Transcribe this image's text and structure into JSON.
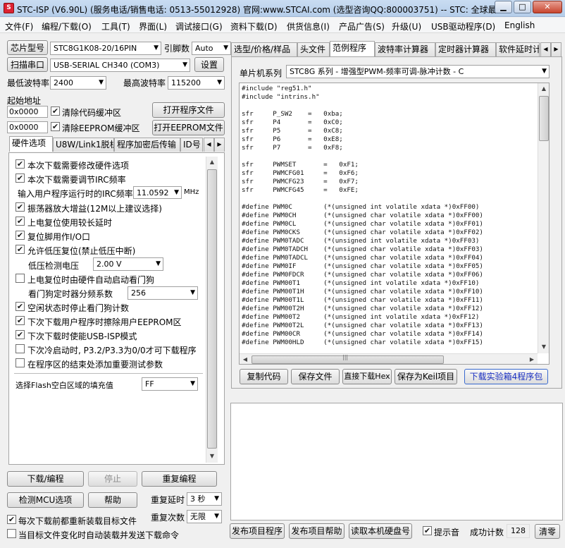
{
  "window": {
    "title": "STC-ISP (V6.90L) (服务电话/销售电话: 0513-55012928) 官网:www.STCAI.com  (选型咨询QQ:800003751) -- STC: 全球最…",
    "icon_letter": "S"
  },
  "menu": [
    "文件(F)",
    "编程/下载(O)",
    "工具(T)",
    "界面(L)",
    "调试接口(G)",
    "资料下载(D)",
    "供货信息(I)",
    "产品广告(S)",
    "升级(U)",
    "USB驱动程序(D)",
    "English"
  ],
  "chip": {
    "label": "芯片型号",
    "value": "STC8G1K08-20/16PIN",
    "pins_label": "引脚数",
    "pins_value": "Auto"
  },
  "port": {
    "button": "扫描串口",
    "value": "USB-SERIAL CH340  (COM3)",
    "settings": "设置"
  },
  "baud": {
    "min_label": "最低波特率",
    "min_value": "2400",
    "max_label": "最高波特率",
    "max_value": "115200"
  },
  "address": {
    "label": "起始地址",
    "code_addr": "0x0000",
    "code_clear": "清除代码缓冲区",
    "open_program": "打开程序文件",
    "eeprom_addr": "0x0000",
    "eeprom_clear": "清除EEPROM缓冲区",
    "open_eeprom": "打开EEPROM文件"
  },
  "left_tabs": [
    "硬件选项",
    "U8W/Link1脱机",
    "程序加密后传输",
    "ID号"
  ],
  "hw": {
    "opt1": "本次下载需要修改硬件选项",
    "opt2": "本次下载需要调节IRC频率",
    "irc_label": "输入用户程序运行时的IRC频率",
    "irc_value": "11.0592",
    "irc_unit": "MHz",
    "opt3": "振荡器放大增益(12M以上建议选择)",
    "opt4": "上电复位使用较长延时",
    "opt5": "复位脚用作I/O口",
    "opt6": "允许低压复位(禁止低压中断)",
    "lv_label": "低压检测电压",
    "lv_value": "2.00 V",
    "opt7": "上电复位时由硬件自动启动看门狗",
    "wdt_label": "看门狗定时器分频系数",
    "wdt_value": "256",
    "opt8": "空闲状态时停止看门狗计数",
    "opt9": "下次下载用户程序时擦除用户EEPROM区",
    "opt10": "下次下载时使能USB-ISP模式",
    "opt11": "下次冷启动时, P3.2/P3.3为0/0才可下载程序",
    "opt12": "在程序区的结束处添加重要测试参数",
    "fill_label": "选择Flash空白区域的填充值",
    "fill_value": "FF"
  },
  "actions": {
    "download": "下载/编程",
    "stop": "停止",
    "reprogram": "重复编程",
    "check_mcu": "检测MCU选项",
    "help": "帮助",
    "delay_label": "重复延时",
    "delay_value": "3 秒",
    "count_label": "重复次数",
    "count_value": "无限",
    "reload_each": "每次下载前都重新装载目标文件",
    "auto_reload": "当目标文件变化时自动装载并发送下载命令"
  },
  "right_tabs": [
    "选型/价格/样品",
    "头文件",
    "范例程序",
    "波特率计算器",
    "定时器计算器",
    "软件延时计"
  ],
  "sample": {
    "series_label": "单片机系列",
    "series_value": "STC8G 系列 - 增强型PWM-频率可调-脉冲计数 - C",
    "code": [
      "#include \"reg51.h\"",
      "#include \"intrins.h\"",
      "",
      "sfr     P_SW2    =   0xba;",
      "sfr     P4       =   0xC0;",
      "sfr     P5       =   0xC8;",
      "sfr     P6       =   0xE8;",
      "sfr     P7       =   0xF8;",
      "",
      "sfr     PWMSET       =   0xF1;",
      "sfr     PWMCFG01     =   0xF6;",
      "sfr     PWMCFG23     =   0xF7;",
      "sfr     PWMCFG45     =   0xFE;",
      "",
      "#define PWM0C        (*(unsigned int volatile xdata *)0xFF00)",
      "#define PWM0CH       (*(unsigned char volatile xdata *)0xFF00)",
      "#define PWM0CL       (*(unsigned char volatile xdata *)0xFF01)",
      "#define PWM0CKS      (*(unsigned char volatile xdata *)0xFF02)",
      "#define PWM0TADC     (*(unsigned int volatile xdata *)0xFF03)",
      "#define PWM0TADCH    (*(unsigned char volatile xdata *)0xFF03)",
      "#define PWM0TADCL    (*(unsigned char volatile xdata *)0xFF04)",
      "#define PWM0IF       (*(unsigned char volatile xdata *)0xFF05)",
      "#define PWM0FDCR     (*(unsigned char volatile xdata *)0xFF06)",
      "#define PWM00T1      (*(unsigned int volatile xdata *)0xFF10)",
      "#define PWM00T1H     (*(unsigned char volatile xdata *)0xFF10)",
      "#define PWM00T1L     (*(unsigned char volatile xdata *)0xFF11)",
      "#define PWM00T2H     (*(unsigned char volatile xdata *)0xFF12)",
      "#define PWM00T2      (*(unsigned int volatile xdata *)0xFF12)",
      "#define PWM00T2L     (*(unsigned char volatile xdata *)0xFF13)",
      "#define PWM00CR      (*(unsigned char volatile xdata *)0xFF14)",
      "#define PWM00HLD     (*(unsigned char volatile xdata *)0xFF15)"
    ],
    "copy": "复制代码",
    "save_file": "保存文件",
    "direct_download": "直接下载Hex",
    "save_keil": "保存为Keil项目",
    "download_kit": "下载实验箱4程序包"
  },
  "bottom": {
    "publish": "发布项目程序",
    "publish_help": "发布项目帮助",
    "read_disk": "读取本机硬盘号",
    "sound": "提示音",
    "success_label": "成功计数",
    "success_value": "128",
    "clear": "清零"
  }
}
